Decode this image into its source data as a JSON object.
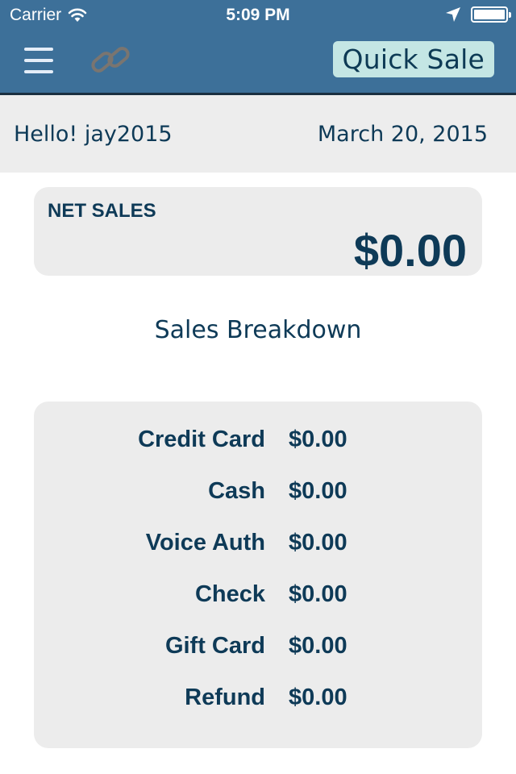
{
  "status_bar": {
    "carrier": "Carrier",
    "time": "5:09 PM",
    "icons": [
      "wifi-icon",
      "location-arrow-icon",
      "battery-icon"
    ],
    "battery_level_percent": 100
  },
  "nav": {
    "menu_icon": "hamburger-menu-icon",
    "link_icon": "chain-link-icon",
    "quick_sale_label": "Quick Sale"
  },
  "greeting": {
    "hello": "Hello! jay2015",
    "date": "March 20, 2015"
  },
  "net_sales": {
    "label": "NET SALES",
    "amount": "$0.00"
  },
  "breakdown": {
    "title": "Sales Breakdown",
    "rows": [
      {
        "name": "Credit Card",
        "value": "$0.00"
      },
      {
        "name": "Cash",
        "value": "$0.00"
      },
      {
        "name": "Voice Auth",
        "value": "$0.00"
      },
      {
        "name": "Check",
        "value": "$0.00"
      },
      {
        "name": "Gift Card",
        "value": "$0.00"
      },
      {
        "name": "Refund",
        "value": "$0.00"
      }
    ]
  },
  "colors": {
    "nav_bar": "#3d7099",
    "quick_sale_bg": "#c4e6e4",
    "text_primary": "#0e3a57",
    "card_bg": "#ececec",
    "link_icon": "#7a7570"
  }
}
